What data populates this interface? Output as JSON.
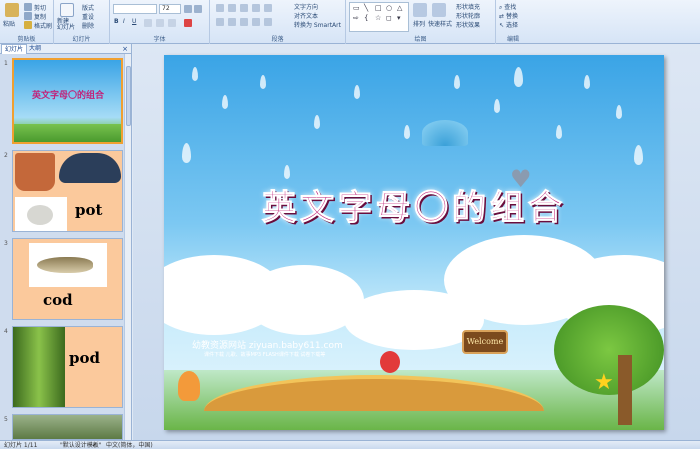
{
  "ribbon": {
    "clipboard": {
      "paste": "粘贴",
      "cut": "剪切",
      "copy": "复制",
      "format_painter": "格式刷",
      "label": "剪贴板"
    },
    "slides": {
      "new_slide": "新建\n幻灯片",
      "layout": "版式",
      "reset": "重设",
      "delete": "删除",
      "label": "幻灯片"
    },
    "font": {
      "size": "72",
      "label": "字体"
    },
    "paragraph": {
      "text_direction": "文字方向",
      "align_text": "对齐文本",
      "smartart": "转换为 SmartArt",
      "label": "段落"
    },
    "drawing": {
      "arrange": "排列",
      "quick_styles": "快速样式",
      "fill": "形状填充",
      "outline": "形状轮廓",
      "effects": "形状效果",
      "label": "绘图"
    },
    "editing": {
      "find": "查找",
      "replace": "替换",
      "select": "选择",
      "label": "编辑"
    }
  },
  "panel": {
    "tabs": [
      "幻灯片",
      "大纲"
    ],
    "close": "×",
    "thumbnails": [
      {
        "num": "1",
        "title": "英文字母〇的组合"
      },
      {
        "num": "2",
        "word": "pot"
      },
      {
        "num": "3",
        "word": "cod"
      },
      {
        "num": "4",
        "word": "pod"
      },
      {
        "num": "5"
      }
    ]
  },
  "slide": {
    "title": "英文字母〇的组合",
    "watermark": "幼教资源网站  ziyuan.baby611.com",
    "watermark_sub": "课件下载   儿歌、故事MP3   FLASH课件下载   试卷下载等",
    "welcome": "Welcome"
  },
  "status": {
    "slide_count": "幻灯片 1/11",
    "theme": "\"默认设计模板\"",
    "language": "中文(简体，中国)"
  },
  "colors": {
    "accent": "#c1237a",
    "sky": "#3aa4e6",
    "thumb_peach": "#fbc99c"
  }
}
